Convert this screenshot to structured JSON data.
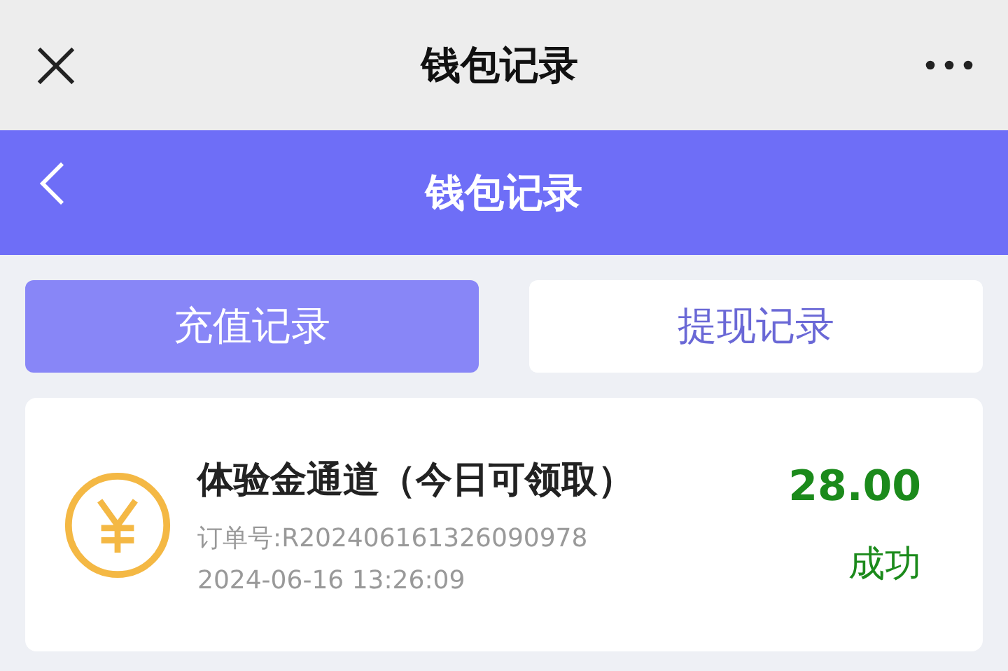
{
  "top_bar": {
    "title": "钱包记录"
  },
  "header": {
    "title": "钱包记录"
  },
  "tabs": [
    {
      "label": "充值记录",
      "selected": true
    },
    {
      "label": "提现记录",
      "selected": false
    }
  ],
  "records": [
    {
      "title": "体验金通道（今日可领取）",
      "order": "订单号:R202406161326090978",
      "time": "2024-06-16 13:26:09",
      "amount": "28.00",
      "status": "成功"
    }
  ]
}
